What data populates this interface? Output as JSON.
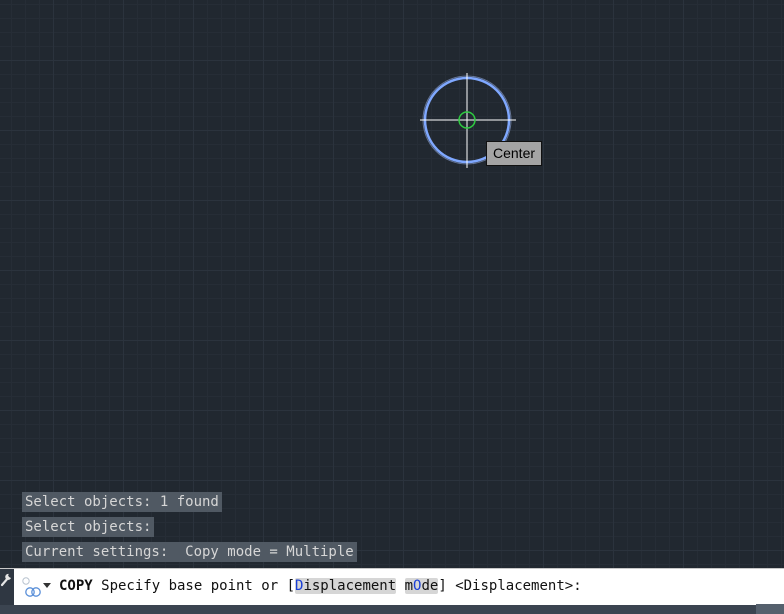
{
  "tooltip": {
    "text": "Center"
  },
  "history": [
    "Select objects: 1 found",
    "Select objects:",
    "Current settings:  Copy mode = Multiple"
  ],
  "command_line": {
    "command": "COPY",
    "prompt_before": " Specify base point or [",
    "option1": {
      "pre": "",
      "hot": "D",
      "post": "isplacement"
    },
    "between": " ",
    "option2": {
      "pre": "m",
      "hot": "O",
      "post": "de"
    },
    "prompt_after": "] <Displacement>:"
  },
  "icons": {
    "handle": "wrench-icon",
    "command": "command-history-icon",
    "caret": "chevron-down-icon"
  },
  "colors": {
    "canvas": "#212830",
    "circle": "#7fa8ff",
    "crosshair": "#ffffff",
    "snap_marker": "#2ecc40",
    "option_hotkey": "#1a3fd6"
  }
}
